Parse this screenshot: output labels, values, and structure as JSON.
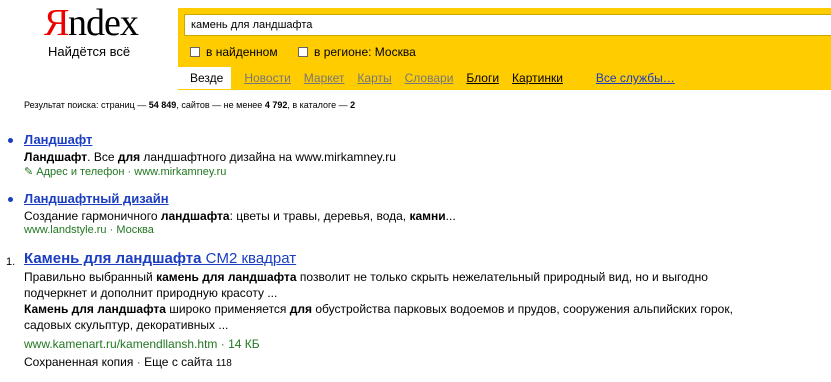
{
  "logo": {
    "first": "Я",
    "rest": "ndex"
  },
  "slogan": "Найдётся всё",
  "search": {
    "query": "камень для ландшафта"
  },
  "filters": [
    {
      "label": "в найденном"
    },
    {
      "label": "в регионе: Москва"
    }
  ],
  "tabs": [
    "Везде",
    "Новости",
    "Маркет",
    "Карты",
    "Словари",
    "Блоги",
    "Картинки",
    "Все службы…"
  ],
  "stats": {
    "prefix": "Результат поиска: страниц —",
    "pages": "54 849",
    "sites_prefix": ", сайтов — не менее",
    "sites": "4 792",
    "catalog_prefix": ", в",
    "catalog_link": "каталоге",
    "catalog_suffix": "—",
    "catalog_count": "2"
  },
  "results": [
    {
      "title": "Ландшафт",
      "snippet_html_parts": [
        "Ландшафт",
        ". Все ",
        "для",
        " ландшафтного дизайна на www.mirkamney.ru"
      ],
      "meta1": "Адрес и телефон",
      "sep": "·",
      "meta2": "www.mirkamney.ru"
    },
    {
      "title": "Ландшафтный дизайн",
      "snippet_parts": [
        "Создание гармоничного ",
        "ландшафта",
        ": цветы и травы, деревья, вода, ",
        "камни",
        "..."
      ],
      "meta1": "www.landstyle.ru",
      "sep": "·",
      "meta2": "Москва"
    },
    {
      "number": "1.",
      "title_bold": "Камень для ландшафта",
      "title_rest": " CM2 квадрат",
      "line1": [
        "Правильно выбранный ",
        "камень для ландшафта",
        " позволит не только скрыть нежелательный природный вид, но и выгодно"
      ],
      "line2": "подчеркнет и дополнит природную красоту ...",
      "line3": [
        "Камень для ландшафта",
        " широко применяется ",
        "для",
        " обустройства парковых водоемов и прудов, сооружения альпийских горок,"
      ],
      "line4": "садовых скульптур, декоративных ...",
      "url": "www.kamenart.ru/kamendllansh.htm",
      "size": "· 14 КБ",
      "cache": "Сохраненная копия",
      "more": "Еще с сайта",
      "more_count": "118"
    }
  ]
}
